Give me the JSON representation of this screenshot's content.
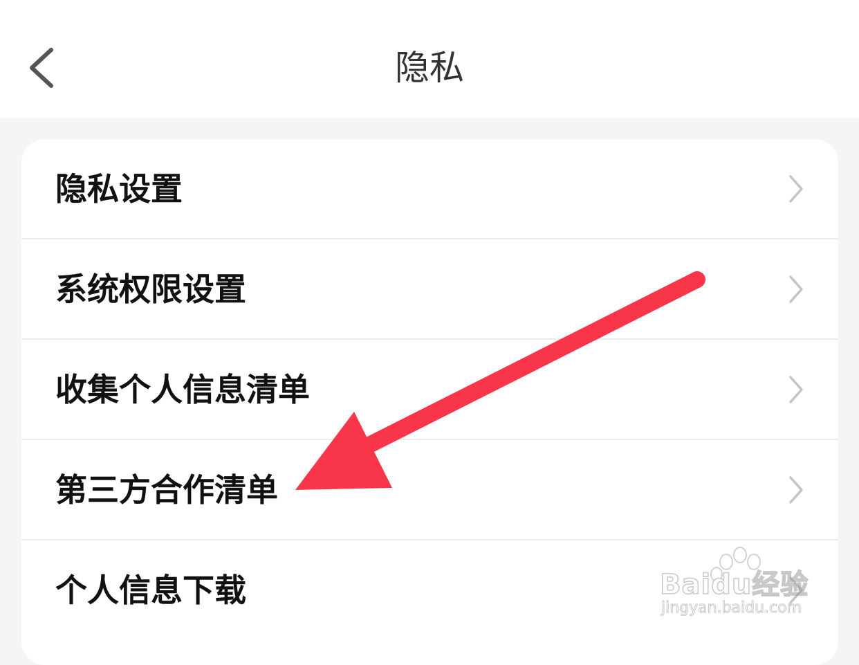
{
  "header": {
    "title": "隐私",
    "back_icon": "chevron-left-icon"
  },
  "menu": {
    "items": [
      {
        "label": "隐私设置",
        "icon": "chevron-right-icon"
      },
      {
        "label": "系统权限设置",
        "icon": "chevron-right-icon"
      },
      {
        "label": "收集个人信息清单",
        "icon": "chevron-right-icon"
      },
      {
        "label": "第三方合作清单",
        "icon": "chevron-right-icon"
      },
      {
        "label": "个人信息下载",
        "icon": "chevron-right-icon"
      }
    ]
  },
  "annotation": {
    "arrow_color": "#f9354a",
    "arrow_points_to": "第三方合作清单"
  },
  "watermark": {
    "brand": "Baidu经验",
    "domain": "jingyan.baidu.com"
  },
  "colors": {
    "page_background": "#f5f5f5",
    "card_background": "#ffffff",
    "text_primary": "#111111",
    "chevron": "#c4c4c4"
  }
}
